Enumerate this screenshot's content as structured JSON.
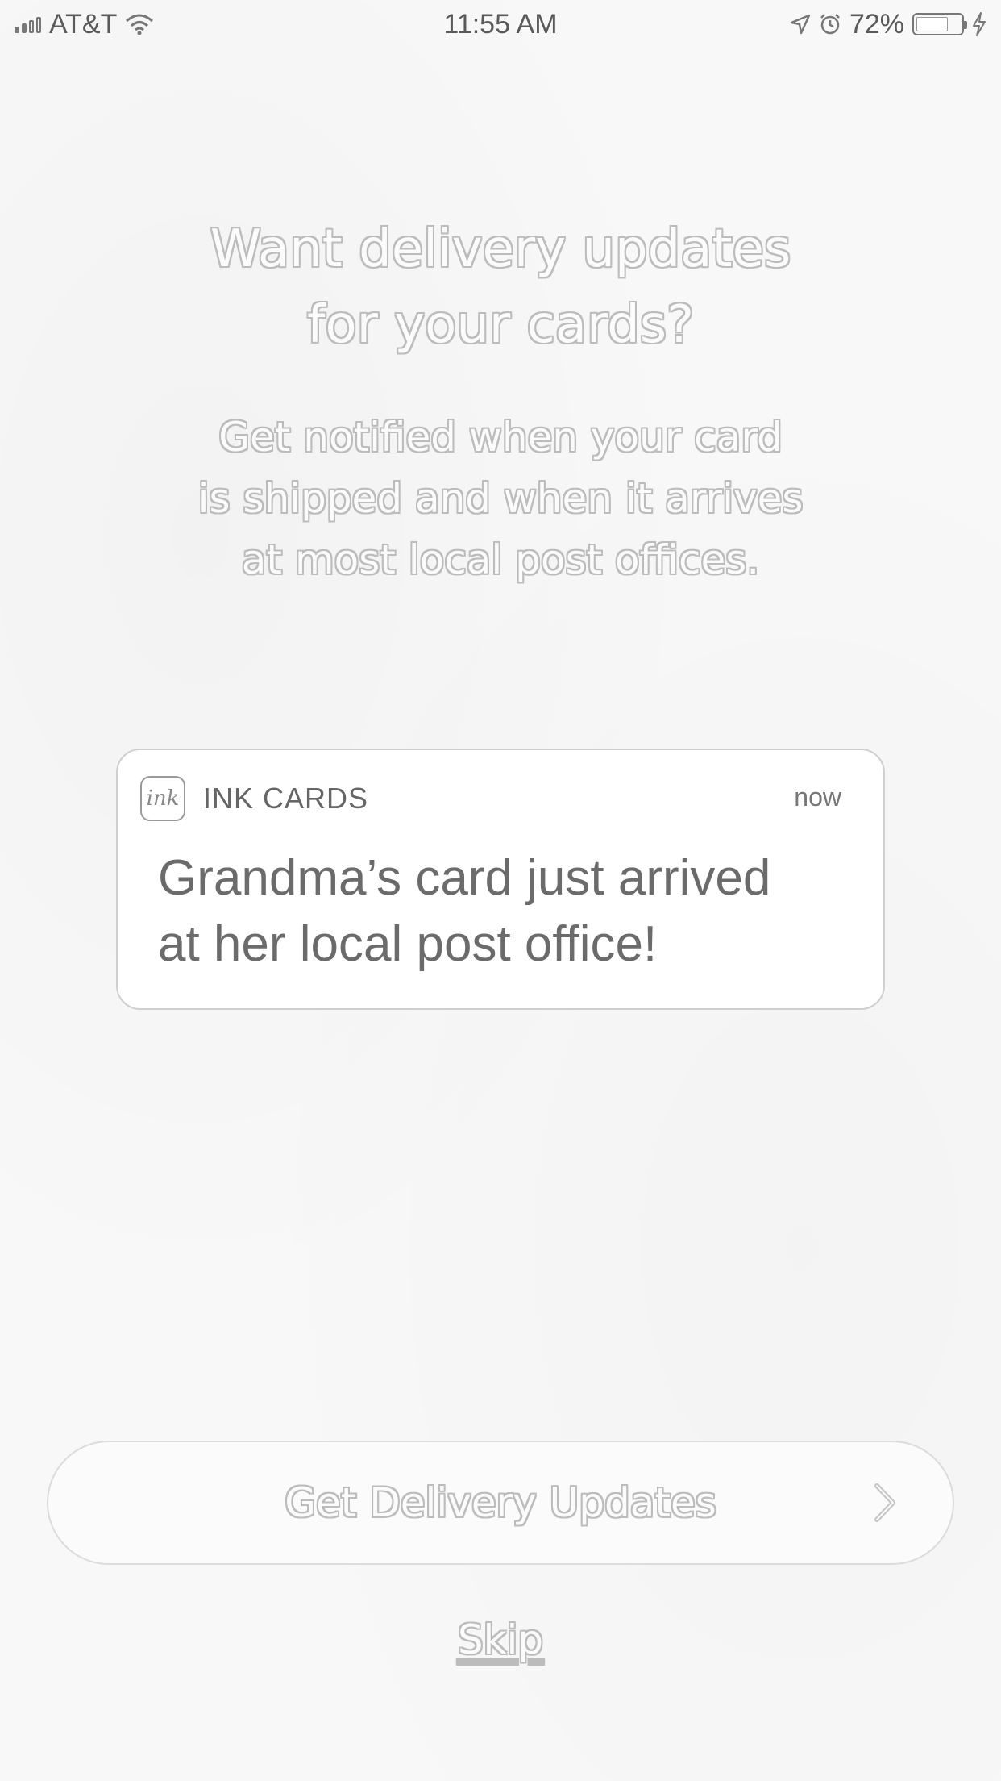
{
  "status_bar": {
    "carrier": "AT&T",
    "time": "11:55 AM",
    "battery_percent": "72%"
  },
  "onboarding": {
    "headline": "Want delivery updates\nfor your cards?",
    "description": "Get notified when your card\nis shipped and when it arrives\nat most local post offices."
  },
  "notification": {
    "app_icon_text": "ink",
    "app_name": "INK CARDS",
    "time": "now",
    "message": "Grandma’s card just arrived\nat her local post office!"
  },
  "actions": {
    "primary_label": "Get Delivery Updates",
    "skip_label": "Skip"
  }
}
